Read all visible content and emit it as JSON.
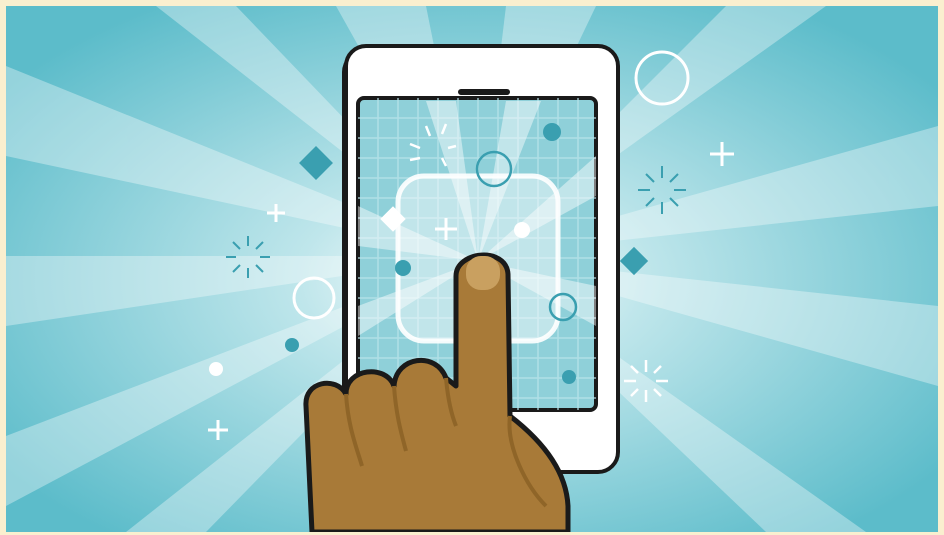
{
  "illustration": {
    "subject": "finger-tapping-smartphone",
    "colors": {
      "border": "#faefcf",
      "sky_light": "#ffffff",
      "sky_mid": "#a8dde4",
      "sky_dark": "#5cbcca",
      "phone_body": "#ffffff",
      "phone_outline": "#1a1a1a",
      "screen": "#8fd0d9",
      "screen_grid": "#b9e3ea",
      "accent_teal": "#3a9fb0",
      "skin": "#a87a38",
      "skin_shadow": "#8f6528",
      "nail": "#c9a060",
      "sparkle": "#ffffff"
    },
    "icons": [
      "phone-icon",
      "hand-icon",
      "sparkle-icon",
      "plus-icon",
      "diamond-icon",
      "circle-ring-icon",
      "dot-icon"
    ]
  }
}
